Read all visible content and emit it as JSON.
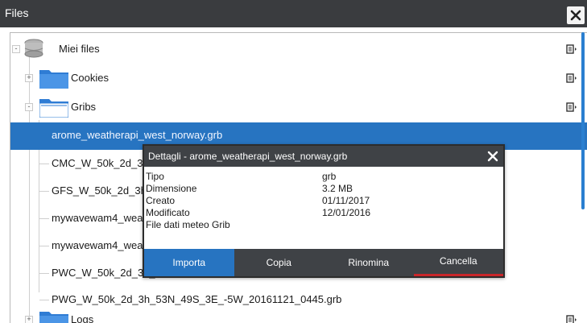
{
  "window": {
    "title": "Files",
    "close_icon": "close-icon"
  },
  "tree": {
    "root": {
      "label": "Miei files",
      "icon": "database-icon",
      "expander": "-"
    },
    "cookies": {
      "label": "Cookies",
      "icon": "folder-icon",
      "expander": "+"
    },
    "gribs": {
      "label": "Gribs",
      "icon": "folder-icon",
      "expander": "-"
    },
    "files": [
      "arome_weatherapi_west_norway.grb",
      "CMC_W_50k_2d_3h_",
      "GFS_W_50k_2d_3h_",
      "mywavewam4_wea",
      "mywavewam4_wea",
      "PWC_W_50k_2d_3h_",
      "PWG_W_50k_2d_3h_53N_49S_3E_-5W_20161121_0445.grb"
    ],
    "logs": {
      "label": "Logs",
      "icon": "folder-icon",
      "expander": "+"
    },
    "more_icon": "context-menu-icon"
  },
  "dialog": {
    "title": "Dettagli - arome_weatherapi_west_norway.grb",
    "properties": [
      {
        "key": "Tipo",
        "value": "grb"
      },
      {
        "key": "Dimensione",
        "value": "3.2 MB"
      },
      {
        "key": "Creato",
        "value": "01/11/2017"
      },
      {
        "key": "Modificato",
        "value": "12/01/2016"
      },
      {
        "key": "File dati meteo Grib",
        "value": ""
      }
    ],
    "actions": {
      "import": "Importa",
      "copy": "Copia",
      "rename": "Rinomina",
      "delete": "Cancella"
    }
  },
  "colors": {
    "titlebar": "#3a3c3f",
    "selection": "#2774c1",
    "dialog_bar": "#3f4246",
    "danger_accent": "#c9262a"
  }
}
